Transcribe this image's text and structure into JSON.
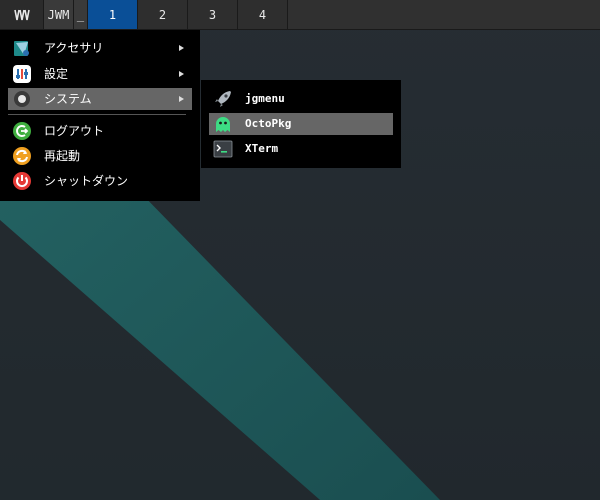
{
  "taskbar": {
    "menu_icon": "jwm-menu-icon",
    "window_title": "JWM",
    "minimize_label": "_",
    "workspaces": [
      {
        "label": "1",
        "active": true
      },
      {
        "label": "2",
        "active": false
      },
      {
        "label": "3",
        "active": false
      },
      {
        "label": "4",
        "active": false
      }
    ]
  },
  "main_menu": {
    "items": [
      {
        "label": "アクセサリ",
        "icon": "accessories-icon",
        "submenu": true
      },
      {
        "label": "設定",
        "icon": "settings-icon",
        "submenu": true
      },
      {
        "label": "システム",
        "icon": "system-icon",
        "submenu": true,
        "highlighted": true
      },
      {
        "label": "ログアウト",
        "icon": "logout-icon",
        "submenu": false
      },
      {
        "label": "再起動",
        "icon": "restart-icon",
        "submenu": false
      },
      {
        "label": "シャットダウン",
        "icon": "shutdown-icon",
        "submenu": false
      }
    ]
  },
  "system_submenu": {
    "items": [
      {
        "label": "jgmenu",
        "icon": "rocket-icon"
      },
      {
        "label": "OctoPkg",
        "icon": "octopkg-ghost-icon",
        "highlighted": true
      },
      {
        "label": "XTerm",
        "icon": "terminal-icon"
      }
    ]
  },
  "colors": {
    "taskbar": "#303030",
    "active_workspace": "#0a4f97",
    "menu_bg": "#000000",
    "highlight": "#666666",
    "desktop": "#232a2f",
    "stripe": "#1f5a5a"
  }
}
